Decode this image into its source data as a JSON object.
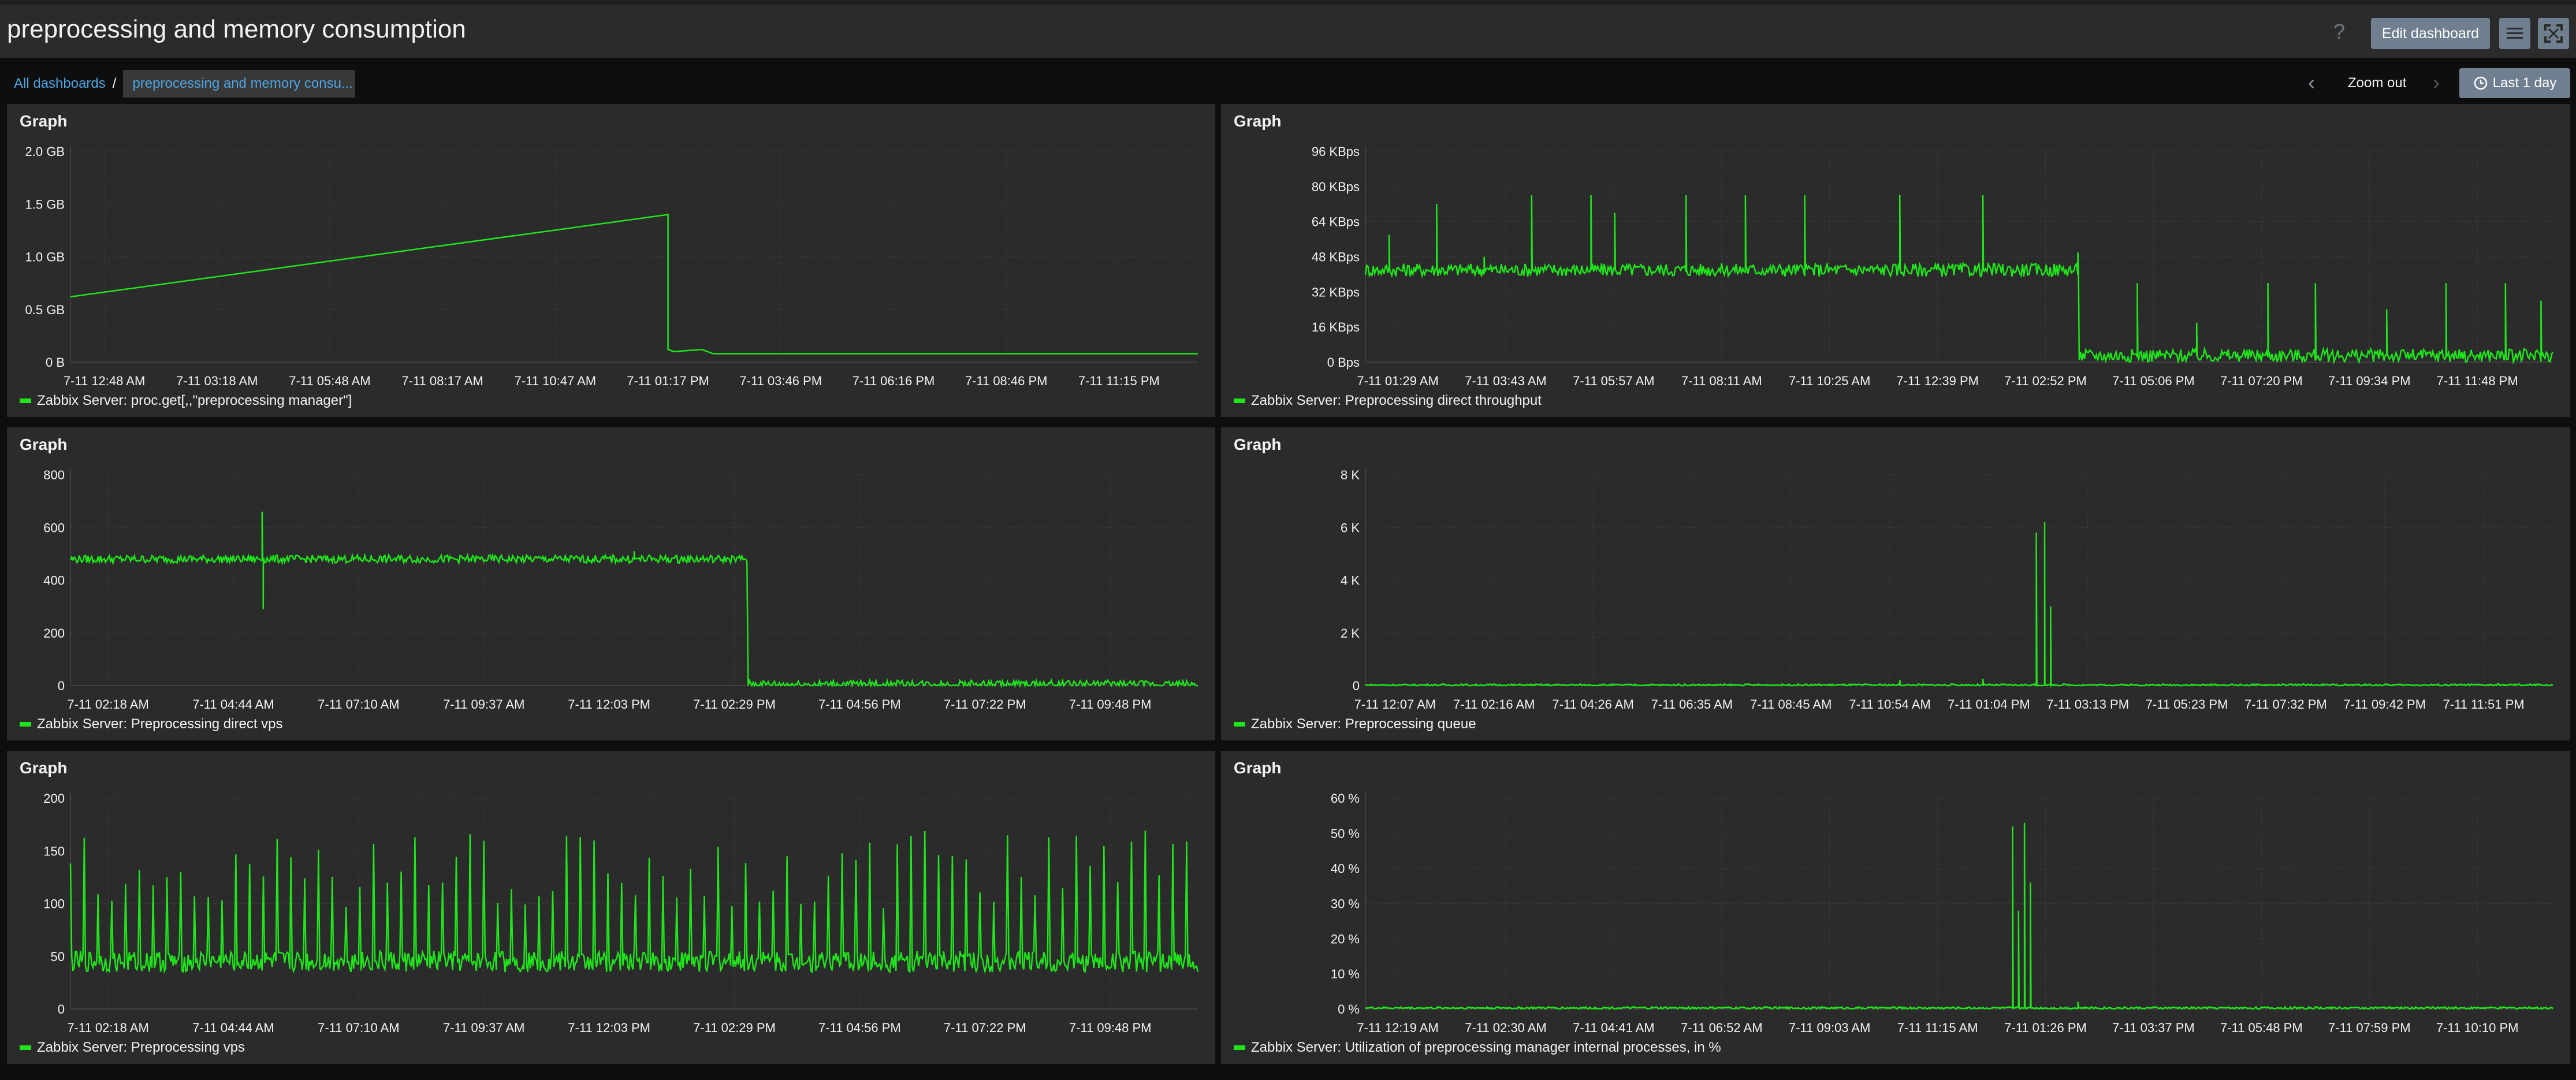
{
  "header": {
    "title": "preprocessing and memory consumption",
    "help": "?",
    "edit_label": "Edit dashboard"
  },
  "breadcrumb": {
    "root": "All dashboards",
    "separator": "/",
    "current": "preprocessing and memory consu..."
  },
  "time": {
    "zoom_out": "Zoom out",
    "period": "Last 1 day"
  },
  "colors": {
    "series": "#1fe61a",
    "accent": "#4ea5e0"
  },
  "widgets": [
    {
      "title": "Graph",
      "legend": "Zabbix Server: proc.get[,,\"preprocessing manager\"]",
      "chart_data": {
        "type": "line",
        "y_ticks": [
          "2.0 GB",
          "1.5 GB",
          "1.0 GB",
          "0.5 GB",
          "0 B"
        ],
        "ylim": [
          0,
          2.0
        ],
        "x_ticks": [
          "7-11 12:48 AM",
          "7-11 03:18 AM",
          "7-11 05:48 AM",
          "7-11 08:17 AM",
          "7-11 10:47 AM",
          "7-11 01:17 PM",
          "7-11 03:46 PM",
          "7-11 06:16 PM",
          "7-11 08:46 PM",
          "7-11 11:15 PM"
        ],
        "x": [
          0,
          0.53,
          0.53,
          0.535,
          0.56,
          0.57,
          1.0
        ],
        "y": [
          0.62,
          1.4,
          0.12,
          0.1,
          0.12,
          0.08,
          0.08
        ],
        "noise": 0,
        "spikes": [],
        "series": [
          {
            "name": "Zabbix Server: proc.get[,,\"preprocessing manager\"]"
          }
        ]
      }
    },
    {
      "title": "Graph",
      "legend": "Zabbix Server: Preprocessing direct throughput",
      "chart_data": {
        "type": "line",
        "y_ticks": [
          "96 KBps",
          "80 KBps",
          "64 KBps",
          "48 KBps",
          "32 KBps",
          "16 KBps",
          "0 Bps"
        ],
        "ylim": [
          0,
          96
        ],
        "x_ticks": [
          "7-11 01:29 AM",
          "7-11 03:43 AM",
          "7-11 05:57 AM",
          "7-11 08:11 AM",
          "7-11 10:25 AM",
          "7-11 12:39 PM",
          "7-11 02:52 PM",
          "7-11 05:06 PM",
          "7-11 07:20 PM",
          "7-11 09:34 PM",
          "7-11 11:48 PM"
        ],
        "x": [
          0,
          0.6,
          0.6,
          1.0
        ],
        "y": [
          42,
          42,
          3,
          3
        ],
        "noise": 3,
        "spikes": [
          [
            0.02,
            58
          ],
          [
            0.06,
            72
          ],
          [
            0.1,
            48
          ],
          [
            0.14,
            76
          ],
          [
            0.19,
            76
          ],
          [
            0.21,
            68
          ],
          [
            0.27,
            76
          ],
          [
            0.32,
            76
          ],
          [
            0.37,
            76
          ],
          [
            0.45,
            76
          ],
          [
            0.52,
            76
          ],
          [
            0.6,
            50
          ],
          [
            0.65,
            36
          ],
          [
            0.7,
            18
          ],
          [
            0.76,
            36
          ],
          [
            0.8,
            36
          ],
          [
            0.86,
            24
          ],
          [
            0.91,
            36
          ],
          [
            0.96,
            36
          ],
          [
            0.99,
            28
          ]
        ],
        "series": [
          {
            "name": "Zabbix Server: Preprocessing direct throughput"
          }
        ]
      }
    },
    {
      "title": "Graph",
      "legend": "Zabbix Server: Preprocessing direct vps",
      "chart_data": {
        "type": "line",
        "y_ticks": [
          "800",
          "600",
          "400",
          "200",
          "0"
        ],
        "ylim": [
          0,
          800
        ],
        "x_ticks": [
          "7-11 02:18 AM",
          "7-11 04:44 AM",
          "7-11 07:10 AM",
          "7-11 09:37 AM",
          "7-11 12:03 PM",
          "7-11 02:29 PM",
          "7-11 04:56 PM",
          "7-11 07:22 PM",
          "7-11 09:48 PM"
        ],
        "x": [
          0,
          0.6,
          0.6,
          1.0
        ],
        "y": [
          480,
          480,
          5,
          5
        ],
        "noise": 15,
        "spikes": [
          [
            0.17,
            660
          ],
          [
            0.171,
            290
          ],
          [
            0.5,
            510
          ]
        ],
        "series": [
          {
            "name": "Zabbix Server: Preprocessing direct vps"
          }
        ]
      }
    },
    {
      "title": "Graph",
      "legend": "Zabbix Server: Preprocessing queue",
      "chart_data": {
        "type": "line",
        "y_ticks": [
          "8 K",
          "6 K",
          "4 K",
          "2 K",
          "0"
        ],
        "ylim": [
          0,
          8000
        ],
        "x_ticks": [
          "7-11 12:07 AM",
          "7-11 02:16 AM",
          "7-11 04:26 AM",
          "7-11 06:35 AM",
          "7-11 08:45 AM",
          "7-11 10:54 AM",
          "7-11 01:04 PM",
          "7-11 03:13 PM",
          "7-11 05:23 PM",
          "7-11 07:32 PM",
          "7-11 09:42 PM",
          "7-11 11:51 PM"
        ],
        "x": [
          0,
          1.0
        ],
        "y": [
          20,
          20
        ],
        "noise": 40,
        "spikes": [
          [
            0.565,
            5800
          ],
          [
            0.572,
            6200
          ],
          [
            0.577,
            3000
          ],
          [
            0.52,
            250
          ],
          [
            0.45,
            200
          ]
        ],
        "series": [
          {
            "name": "Zabbix Server: Preprocessing queue"
          }
        ]
      }
    },
    {
      "title": "Graph",
      "legend": "Zabbix Server: Preprocessing vps",
      "chart_data": {
        "type": "line",
        "y_ticks": [
          "200",
          "150",
          "100",
          "50",
          "0"
        ],
        "ylim": [
          0,
          200
        ],
        "x_ticks": [
          "7-11 02:18 AM",
          "7-11 04:44 AM",
          "7-11 07:10 AM",
          "7-11 09:37 AM",
          "7-11 12:03 PM",
          "7-11 02:29 PM",
          "7-11 04:56 PM",
          "7-11 07:22 PM",
          "7-11 09:48 PM"
        ],
        "x": [
          0,
          1.0
        ],
        "y": [
          45,
          45
        ],
        "noise": 10,
        "spike_interval": 0.012,
        "spike_range": [
          95,
          170
        ],
        "spikes": [],
        "series": [
          {
            "name": "Zabbix Server: Preprocessing vps"
          }
        ]
      }
    },
    {
      "title": "Graph",
      "legend": "Zabbix Server: Utilization of preprocessing manager internal processes, in %",
      "chart_data": {
        "type": "line",
        "y_ticks": [
          "60 %",
          "50 %",
          "40 %",
          "30 %",
          "20 %",
          "10 %",
          "0 %"
        ],
        "ylim": [
          0,
          60
        ],
        "x_ticks": [
          "7-11 12:19 AM",
          "7-11 02:30 AM",
          "7-11 04:41 AM",
          "7-11 06:52 AM",
          "7-11 09:03 AM",
          "7-11 11:15 AM",
          "7-11 01:26 PM",
          "7-11 03:37 PM",
          "7-11 05:48 PM",
          "7-11 07:59 PM",
          "7-11 10:10 PM"
        ],
        "x": [
          0,
          1.0
        ],
        "y": [
          0.3,
          0.3
        ],
        "noise": 0.3,
        "spikes": [
          [
            0.545,
            52
          ],
          [
            0.55,
            28
          ],
          [
            0.555,
            53
          ],
          [
            0.56,
            36
          ],
          [
            0.6,
            2
          ]
        ],
        "series": [
          {
            "name": "Zabbix Server: Utilization of preprocessing manager internal processes, in %"
          }
        ]
      }
    }
  ]
}
